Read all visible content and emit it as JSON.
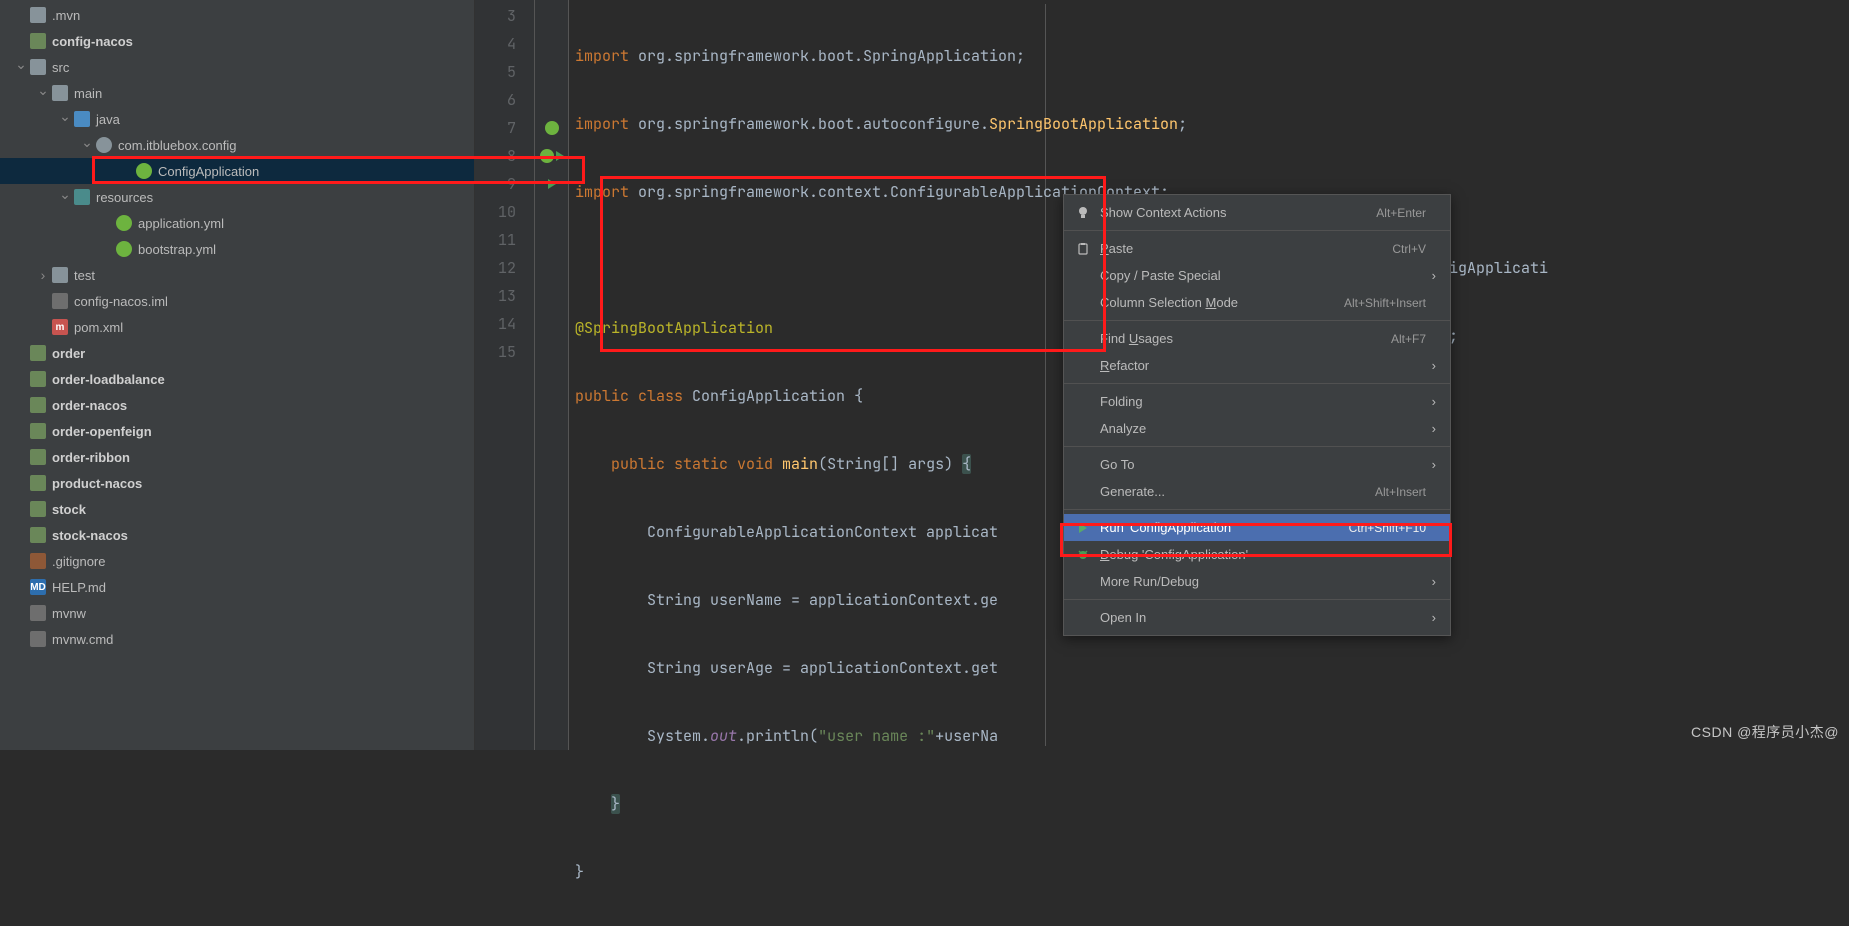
{
  "tree": [
    {
      "indent": 14,
      "arrow": "",
      "icon": "folder-icon",
      "label": ".mvn",
      "bold": false,
      "selected": false
    },
    {
      "indent": 14,
      "arrow": "",
      "icon": "folder-module-icon",
      "label": "config-nacos",
      "bold": true,
      "selected": false
    },
    {
      "indent": 14,
      "arrow": "down",
      "icon": "folder-icon",
      "label": "src",
      "bold": false,
      "selected": false
    },
    {
      "indent": 36,
      "arrow": "down",
      "icon": "folder-icon",
      "label": "main",
      "bold": false,
      "selected": false
    },
    {
      "indent": 58,
      "arrow": "down",
      "icon": "folder-blue-icon",
      "label": "java",
      "bold": false,
      "selected": false
    },
    {
      "indent": 80,
      "arrow": "down",
      "icon": "package-icon",
      "label": "com.itbluebox.config",
      "bold": false,
      "selected": false
    },
    {
      "indent": 120,
      "arrow": "",
      "icon": "springboot-icon",
      "label": "ConfigApplication",
      "bold": false,
      "selected": true
    },
    {
      "indent": 58,
      "arrow": "down",
      "icon": "folder-teal-icon",
      "label": "resources",
      "bold": false,
      "selected": false
    },
    {
      "indent": 100,
      "arrow": "",
      "icon": "spring-icon",
      "label": "application.yml",
      "bold": false,
      "selected": false
    },
    {
      "indent": 100,
      "arrow": "",
      "icon": "spring-icon",
      "label": "bootstrap.yml",
      "bold": false,
      "selected": false
    },
    {
      "indent": 36,
      "arrow": "right",
      "icon": "folder-icon",
      "label": "test",
      "bold": false,
      "selected": false
    },
    {
      "indent": 36,
      "arrow": "",
      "icon": "file-icon",
      "label": "config-nacos.iml",
      "bold": false,
      "selected": false
    },
    {
      "indent": 36,
      "arrow": "",
      "icon": "maven-icon",
      "label": "pom.xml",
      "bold": false,
      "selected": false,
      "iconText": "m"
    },
    {
      "indent": 14,
      "arrow": "",
      "icon": "folder-module-icon",
      "label": "order",
      "bold": true,
      "selected": false
    },
    {
      "indent": 14,
      "arrow": "",
      "icon": "folder-module-icon",
      "label": "order-loadbalance",
      "bold": true,
      "selected": false
    },
    {
      "indent": 14,
      "arrow": "",
      "icon": "folder-module-icon",
      "label": "order-nacos",
      "bold": true,
      "selected": false
    },
    {
      "indent": 14,
      "arrow": "",
      "icon": "folder-module-icon",
      "label": "order-openfeign",
      "bold": true,
      "selected": false
    },
    {
      "indent": 14,
      "arrow": "",
      "icon": "folder-module-icon",
      "label": "order-ribbon",
      "bold": true,
      "selected": false
    },
    {
      "indent": 14,
      "arrow": "",
      "icon": "folder-module-icon",
      "label": "product-nacos",
      "bold": true,
      "selected": false
    },
    {
      "indent": 14,
      "arrow": "",
      "icon": "folder-module-icon",
      "label": "stock",
      "bold": true,
      "selected": false
    },
    {
      "indent": 14,
      "arrow": "",
      "icon": "folder-module-icon",
      "label": "stock-nacos",
      "bold": true,
      "selected": false
    },
    {
      "indent": 14,
      "arrow": "",
      "icon": "gitignore-icon",
      "label": ".gitignore",
      "bold": false,
      "selected": false
    },
    {
      "indent": 14,
      "arrow": "",
      "icon": "md-icon",
      "label": "HELP.md",
      "bold": false,
      "selected": false,
      "iconText": "MD"
    },
    {
      "indent": 14,
      "arrow": "",
      "icon": "file-icon",
      "label": "mvnw",
      "bold": false,
      "selected": false
    },
    {
      "indent": 14,
      "arrow": "",
      "icon": "file-icon",
      "label": "mvnw.cmd",
      "bold": false,
      "selected": false
    }
  ],
  "gutter_start": 3,
  "gutter_end": 15,
  "menu": [
    {
      "type": "item",
      "icon": "bulb",
      "label": "Show Context Actions",
      "shortcut": "Alt+Enter",
      "arrow": false,
      "selected": false,
      "name": "ctx-actions"
    },
    {
      "type": "sep"
    },
    {
      "type": "item",
      "icon": "paste",
      "labelPrefix": "",
      "underline": "P",
      "labelSuffix": "aste",
      "shortcut": "Ctrl+V",
      "arrow": false,
      "selected": false,
      "name": "paste"
    },
    {
      "type": "item",
      "icon": "",
      "label": "Copy / Paste Special",
      "shortcut": "",
      "arrow": true,
      "selected": false,
      "name": "copy-paste-special"
    },
    {
      "type": "item",
      "icon": "",
      "labelPrefix": "Column Selection ",
      "underline": "M",
      "labelSuffix": "ode",
      "shortcut": "Alt+Shift+Insert",
      "arrow": false,
      "selected": false,
      "name": "column-selection"
    },
    {
      "type": "sep"
    },
    {
      "type": "item",
      "icon": "",
      "labelPrefix": "Find ",
      "underline": "U",
      "labelSuffix": "sages",
      "shortcut": "Alt+F7",
      "arrow": false,
      "selected": false,
      "name": "find-usages"
    },
    {
      "type": "item",
      "icon": "",
      "labelPrefix": "",
      "underline": "R",
      "labelSuffix": "efactor",
      "shortcut": "",
      "arrow": true,
      "selected": false,
      "name": "refactor"
    },
    {
      "type": "sep"
    },
    {
      "type": "item",
      "icon": "",
      "label": "Folding",
      "shortcut": "",
      "arrow": true,
      "selected": false,
      "name": "folding"
    },
    {
      "type": "item",
      "icon": "",
      "label": "Analyze",
      "shortcut": "",
      "arrow": true,
      "selected": false,
      "name": "analyze"
    },
    {
      "type": "sep"
    },
    {
      "type": "item",
      "icon": "",
      "label": "Go To",
      "shortcut": "",
      "arrow": true,
      "selected": false,
      "name": "go-to"
    },
    {
      "type": "item",
      "icon": "",
      "label": "Generate...",
      "shortcut": "Alt+Insert",
      "arrow": false,
      "selected": false,
      "name": "generate"
    },
    {
      "type": "sep"
    },
    {
      "type": "item",
      "icon": "run",
      "label": "Run 'ConfigApplication'",
      "shortcut": "Ctrl+Shift+F10",
      "arrow": false,
      "selected": true,
      "name": "run-config"
    },
    {
      "type": "item",
      "icon": "debug",
      "labelPrefix": "",
      "underline": "D",
      "labelSuffix": "ebug 'ConfigApplication'",
      "shortcut": "",
      "arrow": false,
      "selected": false,
      "name": "debug-config"
    },
    {
      "type": "item",
      "icon": "",
      "label": "More Run/Debug",
      "shortcut": "",
      "arrow": true,
      "selected": false,
      "name": "more-run-debug"
    },
    {
      "type": "sep"
    },
    {
      "type": "item",
      "icon": "",
      "label": "Open In",
      "shortcut": "",
      "arrow": true,
      "selected": false,
      "name": "open-in"
    }
  ],
  "code_behind": {
    "line1": "figApplicati",
    "line2": ");"
  },
  "watermark": "CSDN @程序员小杰@"
}
